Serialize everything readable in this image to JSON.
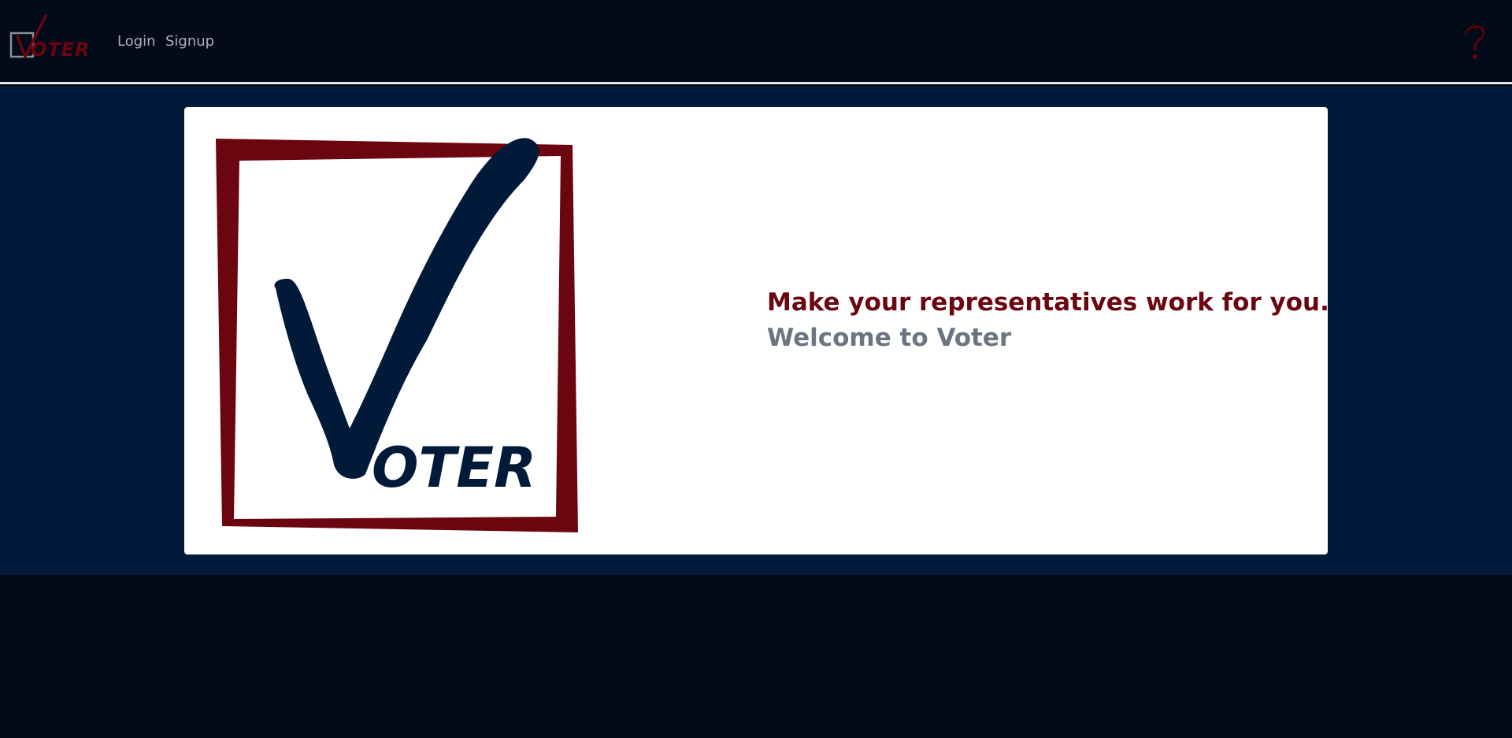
{
  "navbar": {
    "brand_text": "VOTER",
    "links": [
      {
        "label": "Login"
      },
      {
        "label": "Signup"
      }
    ],
    "help_icon": "question-mark-icon"
  },
  "hero": {
    "logo_text": "OTER",
    "headline": "Make your representatives work for you.",
    "subline": "Welcome to Voter"
  },
  "colors": {
    "page_background": "#010b1a",
    "hero_background": "#011a3a",
    "brand_red": "#6b050f",
    "brand_navy": "#011a3a",
    "muted_text": "#6b7480"
  }
}
